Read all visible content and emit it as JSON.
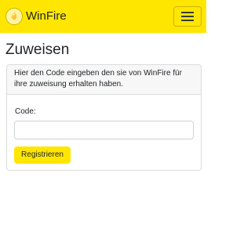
{
  "navbar": {
    "brand_text": "WinFire",
    "logo_text": "WinFire",
    "logo_icon": "winfire-logo",
    "toggle_icon": "hamburger-menu-icon",
    "background_color": "#ffe600"
  },
  "page": {
    "title": "Zuweisen"
  },
  "card": {
    "header_text": "Hier den Code eingeben den sie von WinFire für ihre zuweisung erhalten haben.",
    "code_label": "Code:",
    "code_value": "",
    "code_placeholder": "",
    "submit_label": "Registrieren",
    "button_color": "#ffe600"
  }
}
